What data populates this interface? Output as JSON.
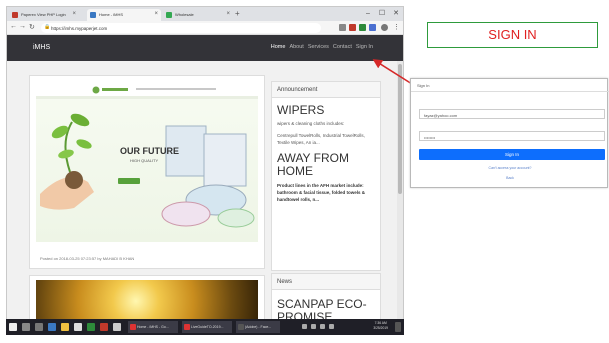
{
  "browser": {
    "tabs": [
      {
        "label": "Paperex View PHP Login",
        "color": "#c0392b"
      },
      {
        "label": "Home - iMHS",
        "color": "#3a78c2"
      },
      {
        "label": "Wholesale",
        "color": "#33a852"
      }
    ],
    "new_tab": "+",
    "window_controls": [
      "–",
      "☐",
      "✕"
    ],
    "url": "https://imhs.mypaperjet.com"
  },
  "site": {
    "brand": "iMHS",
    "menu": [
      "Home",
      "About",
      "Services",
      "Contact",
      "Sign In"
    ]
  },
  "post": {
    "banner_headline": "OUR FUTURE",
    "banner_sub": "HIGH QUALITY",
    "posted": "Posted on 2018-03-25 07:23:57 by MAHADI B KHAN"
  },
  "sidebar": {
    "announcement_title": "Announcement",
    "item1_title": "WIPERS",
    "item1_desc": "wipers & cleaning cloths includes:",
    "item1_detail": "Centrepull TowelRolls, Industrial TowelRolls, Textile Wipes, An ia...",
    "item2_title": "AWAY FROM HOME",
    "item2_desc": "Product lines in the AFH market include: bathroom & facial tissue, folded towels & handtowel rolls, n...",
    "news_title": "News",
    "news_item": "SCANPAP ECO-PROMISE"
  },
  "taskbar": {
    "apps": [
      "Home - iMHS - Go...",
      "LiveGuideTO-2019...",
      "(Adobe) - Face..."
    ],
    "time": "7:36 AM",
    "date": "3/25/2019"
  },
  "callout": {
    "label": "SIGN IN",
    "border_color": "#2e9b3c",
    "text_color": "#e02020"
  },
  "dialog": {
    "title": "Sign In",
    "email": "fayaz@yahoo.com",
    "password": "••••••••",
    "button": "Sign In",
    "forgot": "Can't access your account?",
    "back": "Back"
  }
}
